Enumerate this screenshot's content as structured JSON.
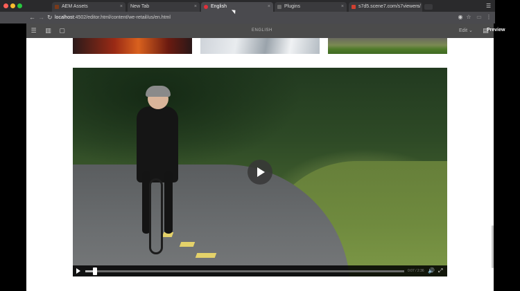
{
  "browser": {
    "tabs": [
      {
        "title": "AEM Assets",
        "favicon_color": "#7a3a1a",
        "active": false
      },
      {
        "title": "New Tab",
        "favicon_color": "",
        "active": false
      },
      {
        "title": "English",
        "favicon_color": "#e0303a",
        "active": true
      },
      {
        "title": "Plugins",
        "favicon_color": "#6a6a6a",
        "active": false
      },
      {
        "title": "s7d5.scene7.com/s7viewers/",
        "favicon_color": "#d04030",
        "active": false
      }
    ],
    "close_glyph": "×",
    "url_host": "localhost",
    "url_path": ":4502/editor.html/content/we-retail/us/en.html",
    "icons": [
      "back-arrow-icon",
      "forward-arrow-icon",
      "reload-icon",
      "info-icon",
      "extension-icon",
      "star-icon",
      "cast-icon",
      "menu-icon"
    ]
  },
  "aem_toolbar": {
    "page_label": "ENGLISH",
    "edit_label": "Edit",
    "edit_caret": "⌄",
    "preview_label": "Preview",
    "icons": [
      "side-panel-icon",
      "page-properties-icon",
      "annotations-icon",
      "emulator-icon"
    ]
  },
  "video_player": {
    "progress_fraction": 0.03,
    "timecode": "0:07 / 2:36",
    "volume_glyph": "🔊",
    "fullscreen_glyph": "⤢"
  },
  "colors": {
    "chrome_dark": "#2a2a2c",
    "chrome_mid": "#4a4a4e",
    "aem_toolbar": "#4b4b4b",
    "page_bg": "#ffffff"
  }
}
